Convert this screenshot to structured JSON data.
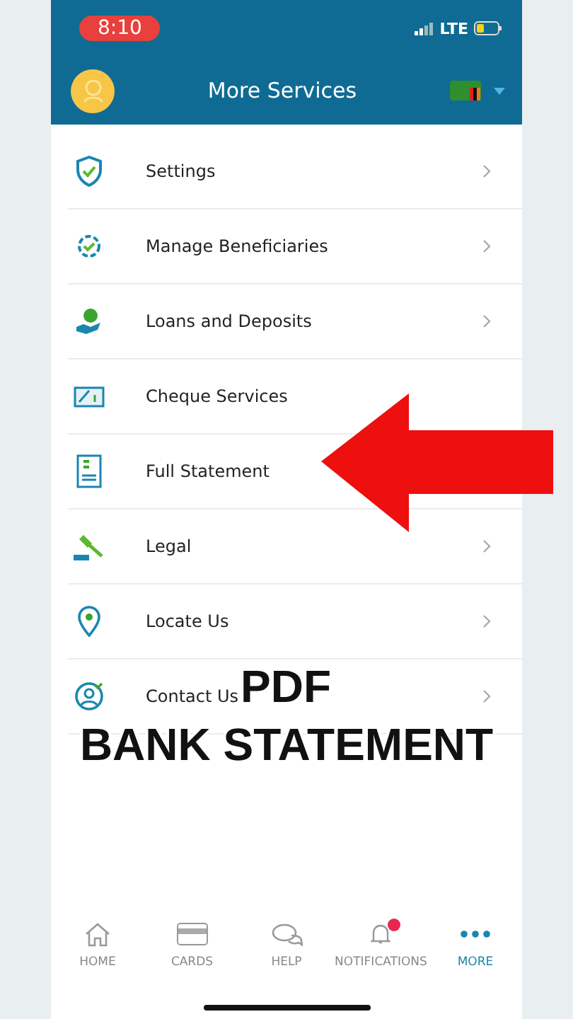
{
  "status_bar": {
    "time": "8:10",
    "network": "LTE"
  },
  "header": {
    "title": "More Services"
  },
  "menu": [
    {
      "kind": "shield",
      "label": "Settings"
    },
    {
      "kind": "gear",
      "label": "Manage Beneficiaries"
    },
    {
      "kind": "hand",
      "label": "Loans and Deposits"
    },
    {
      "kind": "cheque",
      "label": "Cheque Services"
    },
    {
      "kind": "statement",
      "label": "Full Statement"
    },
    {
      "kind": "gavel",
      "label": "Legal"
    },
    {
      "kind": "pin",
      "label": "Locate Us"
    },
    {
      "kind": "contact",
      "label": "Contact Us"
    }
  ],
  "tab_bar": [
    {
      "kind": "home",
      "label": "HOME",
      "selected": false,
      "badge": false
    },
    {
      "kind": "card",
      "label": "CARDS",
      "selected": false,
      "badge": false
    },
    {
      "kind": "chat",
      "label": "HELP",
      "selected": false,
      "badge": false
    },
    {
      "kind": "bell",
      "label": "NOTIFICATIONS",
      "selected": false,
      "badge": true
    },
    {
      "kind": "dots",
      "label": "MORE",
      "selected": true,
      "badge": false
    }
  ],
  "overlay": {
    "caption_lines": [
      "PDF",
      "BANK STATEMENT"
    ]
  }
}
